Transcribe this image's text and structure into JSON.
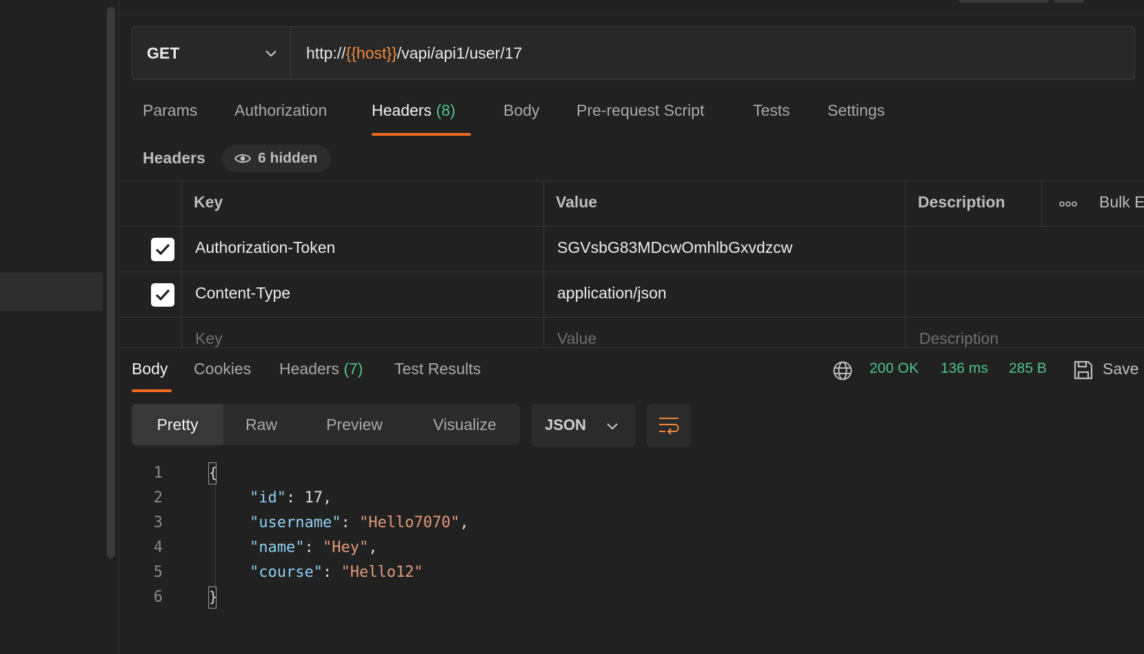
{
  "request": {
    "method": "GET",
    "url_parts": {
      "prefix": "http://",
      "variable": "{{host}}",
      "suffix": "/vapi/api1/user/17"
    }
  },
  "request_tabs": {
    "params": "Params",
    "authorization": "Authorization",
    "headers": "Headers",
    "headers_count": "(8)",
    "body": "Body",
    "prerequest": "Pre-request Script",
    "tests": "Tests",
    "settings": "Settings"
  },
  "headers_section": {
    "label": "Headers",
    "hidden": "6 hidden"
  },
  "headers_table": {
    "columns": {
      "key": "Key",
      "value": "Value",
      "description": "Description",
      "bulk": "Bulk E"
    },
    "rows": [
      {
        "checked": true,
        "key": "Authorization-Token",
        "value": "SGVsbG83MDcwOmhlbGxvdzcw"
      },
      {
        "checked": true,
        "key": "Content-Type",
        "value": "application/json"
      }
    ],
    "placeholders": {
      "key": "Key",
      "value": "Value",
      "description": "Description"
    }
  },
  "response_tabs": {
    "body": "Body",
    "cookies": "Cookies",
    "headers": "Headers",
    "headers_count": "(7)",
    "test_results": "Test Results"
  },
  "response_status": {
    "status": "200 OK",
    "time": "136 ms",
    "size": "285 B",
    "save": "Save"
  },
  "view_modes": [
    "Pretty",
    "Raw",
    "Preview",
    "Visualize"
  ],
  "active_view_mode": "Pretty",
  "format": "JSON",
  "code": {
    "line_numbers": [
      "1",
      "2",
      "3",
      "4",
      "5",
      "6"
    ],
    "open_brace": "{",
    "close_brace": "}",
    "lines": [
      {
        "key": "\"id\"",
        "sep": ": ",
        "value": "17",
        "value_type": "number",
        "trail": ","
      },
      {
        "key": "\"username\"",
        "sep": ": ",
        "value": "\"Hello7070\"",
        "value_type": "string",
        "trail": ","
      },
      {
        "key": "\"name\"",
        "sep": ": ",
        "value": "\"Hey\"",
        "value_type": "string",
        "trail": ","
      },
      {
        "key": "\"course\"",
        "sep": ": ",
        "value": "\"Hello12\"",
        "value_type": "string",
        "trail": ""
      }
    ]
  },
  "colors": {
    "accent": "#f26b21",
    "success": "#4ec48a",
    "variable": "#f08a3c",
    "json_key": "#8dd1f2",
    "json_string": "#e29a7a"
  }
}
